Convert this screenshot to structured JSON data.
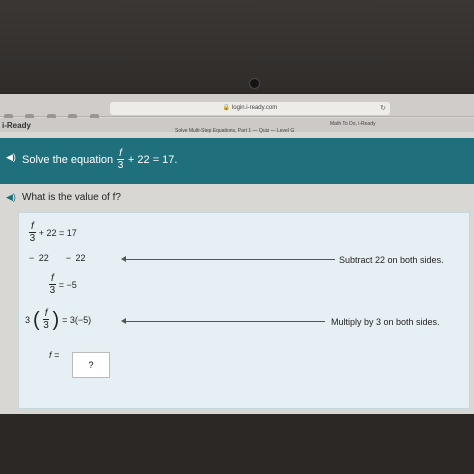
{
  "browser": {
    "url": "login.i-ready.com"
  },
  "app": {
    "logo": "i-Ready",
    "lesson_title": "Solve Multi-Step Equations, Part 1 — Quiz — Level G",
    "user_label": "Math To Do, i-Ready"
  },
  "problem": {
    "prefix": "Solve the equation",
    "numerator": "f",
    "denominator": "3",
    "suffix": "+ 22 = 17."
  },
  "question": {
    "text": "What is the value of f?"
  },
  "work": {
    "step1": {
      "num": "f",
      "den": "3",
      "rest": "+ 22 = 17"
    },
    "step2": {
      "left": "− 22",
      "right": "− 22"
    },
    "note1": "Subtract 22 on both sides.",
    "step3": {
      "num": "f",
      "den": "3",
      "rest": "= −5"
    },
    "step4": {
      "coef": "3",
      "num": "f",
      "den": "3",
      "rest": "= 3(−5)"
    },
    "note2": "Multiply by 3 on both sides.",
    "step5": {
      "label": "f =",
      "answer": "?"
    }
  }
}
